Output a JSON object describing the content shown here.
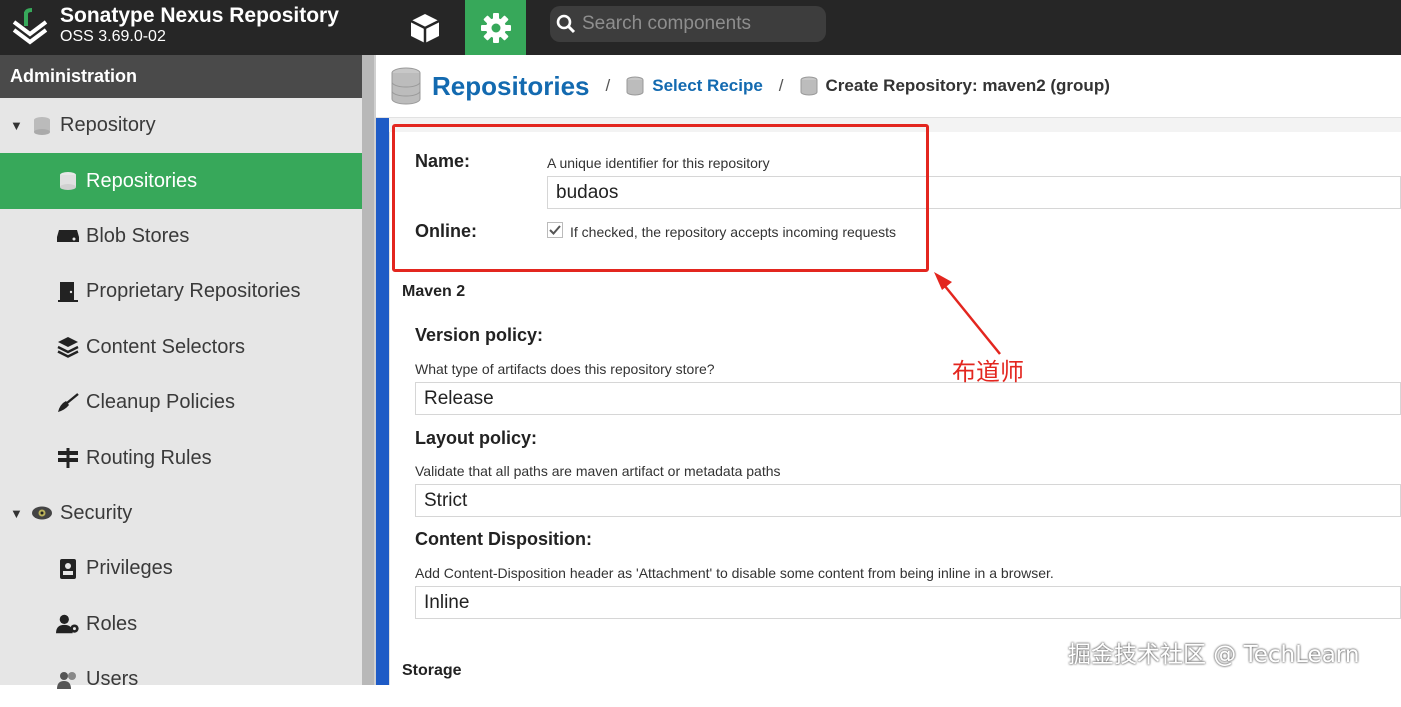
{
  "header": {
    "app_name": "Sonatype Nexus Repository",
    "version": "OSS 3.69.0-02",
    "search_placeholder": "Search components"
  },
  "sidebar": {
    "title": "Administration",
    "groups": [
      {
        "label": "Repository",
        "items": [
          "Repositories",
          "Blob Stores",
          "Proprietary Repositories",
          "Content Selectors",
          "Cleanup Policies",
          "Routing Rules"
        ]
      },
      {
        "label": "Security",
        "items": [
          "Privileges",
          "Roles",
          "Users"
        ]
      }
    ],
    "active_item": "Repositories"
  },
  "breadcrumb": {
    "title": "Repositories",
    "sep": "/",
    "link": "Select Recipe",
    "current": "Create Repository: maven2 (group)"
  },
  "form": {
    "name_label": "Name:",
    "name_help": "A unique identifier for this repository",
    "name_value": "budaos",
    "online_label": "Online:",
    "online_help": "If checked, the repository accepts incoming requests",
    "online_checked": true,
    "maven_section": "Maven 2",
    "version_policy_label": "Version policy:",
    "version_policy_help": "What type of artifacts does this repository store?",
    "version_policy_value": "Release",
    "layout_policy_label": "Layout policy:",
    "layout_policy_help": "Validate that all paths are maven artifact or metadata paths",
    "layout_policy_value": "Strict",
    "content_disposition_label": "Content Disposition:",
    "content_disposition_help": "Add Content-Disposition header as 'Attachment' to disable some content from being inline in a browser.",
    "content_disposition_value": "Inline",
    "storage_section": "Storage"
  },
  "annotation": {
    "text": "布道师",
    "color": "#e3261f"
  },
  "watermark": "掘金技术社区 @ TechLearn",
  "colors": {
    "header_bg": "#262626",
    "accent_green": "#37a85a",
    "link_blue": "#136ab0",
    "sidebar_bg": "#e6e6e6",
    "highlight_red": "#e3261f"
  }
}
